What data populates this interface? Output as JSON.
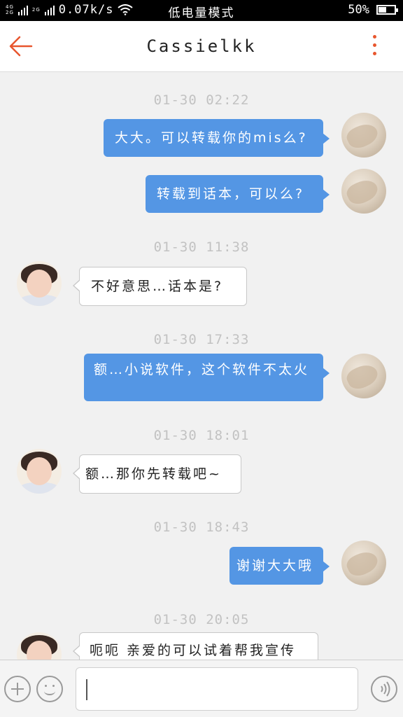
{
  "status_bar": {
    "network_tag_top": "4G",
    "network_tag_bottom": "2G",
    "network_tag_mid": "2G",
    "speed": "0.07k/s",
    "mode": "低电量模式",
    "battery": "50%",
    "battery_level_pct": 50,
    "icons": [
      "signal-icon",
      "wifi-icon",
      "battery-icon"
    ]
  },
  "header": {
    "title": "Cassielkk",
    "back_icon": "arrow-left-icon",
    "more_icon": "more-vertical-icon",
    "accent_color": "#e8562e"
  },
  "colors": {
    "outgoing_bubble": "#5496e4",
    "incoming_bubble": "#ffffff",
    "timestamp": "#c2c2c2",
    "background": "#f1f1f1"
  },
  "messages": [
    {
      "time": "01-30 02:22"
    },
    {
      "dir": "out",
      "text": "大大。可以转载你的mis么?"
    },
    {
      "dir": "out",
      "text": "转载到话本，可以么?"
    },
    {
      "time": "01-30 11:38"
    },
    {
      "dir": "in",
      "text": "不好意思…话本是?"
    },
    {
      "time": "01-30 17:33"
    },
    {
      "dir": "out",
      "text": "额…小说软件，这个软件不太火"
    },
    {
      "time": "01-30 18:01"
    },
    {
      "dir": "in",
      "text": "额…那你先转载吧~"
    },
    {
      "time": "01-30 18:43"
    },
    {
      "dir": "out",
      "text": "谢谢大大哦"
    },
    {
      "time": "01-30 20:05"
    },
    {
      "dir": "in",
      "text": "呃呃 亲爱的可以试着帮我宣传"
    }
  ],
  "input_bar": {
    "plus_icon": "plus-circle-icon",
    "emoji_icon": "smiley-icon",
    "voice_icon": "voice-icon",
    "message_value": ""
  }
}
